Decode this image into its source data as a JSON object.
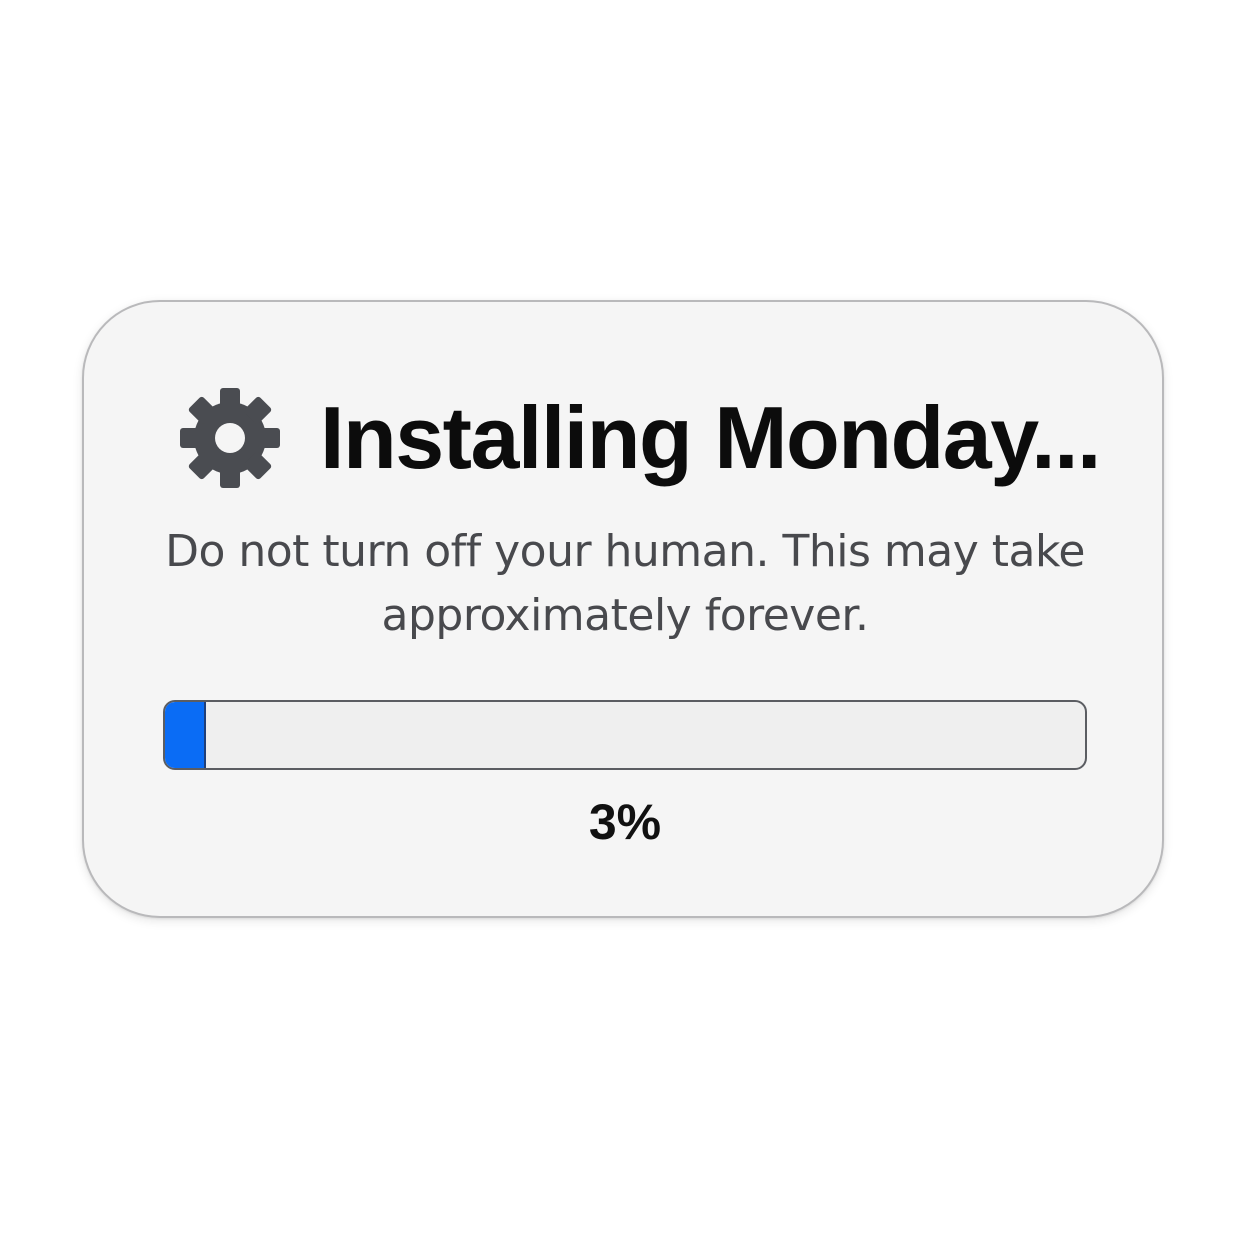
{
  "dialog": {
    "icon": "gear-icon",
    "title": "Installing Monday...",
    "message": "Do not turn off your human. This may take approximately forever.",
    "progress": {
      "value_percent": 3,
      "label": "3%",
      "fill_color": "#0a6cf5",
      "track_color": "#efefef"
    }
  },
  "colors": {
    "icon": "#4a4c51",
    "title_text": "#0c0c0c",
    "message_text": "#48494d",
    "panel_background": "#f5f5f5"
  }
}
